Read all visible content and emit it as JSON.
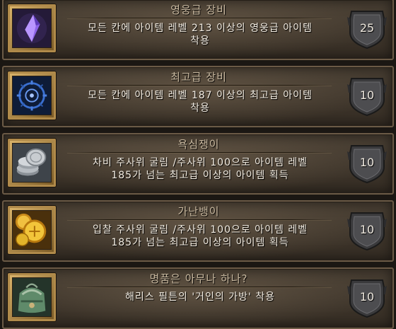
{
  "achievements": [
    {
      "title": "영웅급 장비",
      "description": "모든 칸에 아이템 레벨 213 이상의 영웅급 아이템\n착용",
      "points": "25",
      "icon": "purple-gem-icon",
      "icon_color": "#7a4ad6"
    },
    {
      "title": "최고급 장비",
      "description": "모든 칸에 아이템 레벨 187 이상의 최고급 아이템\n착용",
      "points": "10",
      "icon": "blue-sigil-icon",
      "icon_color": "#3a6fd0"
    },
    {
      "title": "욕심쟁이",
      "description": "차비 주사위 굴림 /주사위 100으로 아이템 레벨\n185가 넘는 최고급 이상의 아이템 획득",
      "points": "10",
      "icon": "silver-coins-icon",
      "icon_color": "#c8ccd0"
    },
    {
      "title": "가난뱅이",
      "description": "입찰 주사위 굴림 /주사위 100으로 아이템 레벨\n185가 넘는 최고급 이상의 아이템 획득",
      "points": "10",
      "icon": "gold-coins-icon",
      "icon_color": "#e2b32a"
    },
    {
      "title": "명품은 아무나 하나?",
      "description": "해리스 필튼의 '거인의 가방' 착용",
      "points": "10",
      "icon": "bag-icon",
      "icon_color": "#5f8a6a"
    }
  ]
}
